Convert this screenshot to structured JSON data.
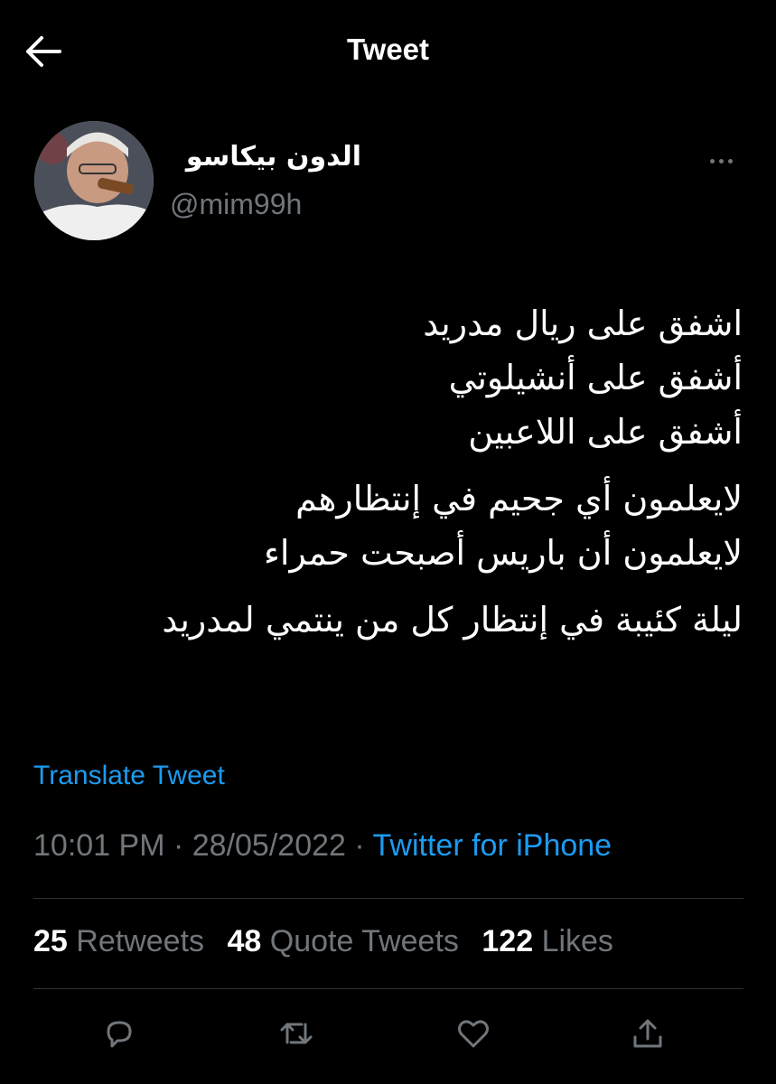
{
  "header": {
    "title": "Tweet"
  },
  "author": {
    "display_name": "الدون بيكاسو",
    "handle": "@mim99h"
  },
  "tweet": {
    "paragraphs": [
      [
        "اشفق على ريال مدريد",
        "أشفق على أنشيلوتي",
        "أشفق على اللاعبين"
      ],
      [
        "لايعلمون أي جحيم في إنتظارهم",
        "لايعلمون أن باريس أصبحت حمراء"
      ],
      [
        "ليلة كئيبة في إنتظار كل من ينتمي لمدريد"
      ]
    ],
    "translate_label": "Translate Tweet"
  },
  "meta": {
    "time": "10:01 PM",
    "sep": " · ",
    "date": "28/05/2022",
    "source": "Twitter for iPhone"
  },
  "stats": {
    "retweets": {
      "count": "25",
      "label": "Retweets"
    },
    "quotes": {
      "count": "48",
      "label": "Quote Tweets"
    },
    "likes": {
      "count": "122",
      "label": "Likes"
    }
  },
  "icons": {
    "back": "arrow-left-icon",
    "more": "more-dots-icon",
    "reply": "reply-icon",
    "retweet": "retweet-icon",
    "like": "heart-icon",
    "share": "share-icon"
  },
  "colors": {
    "background": "#000000",
    "link": "#1d9bf0",
    "muted": "#71767b",
    "divider": "#2f3336"
  }
}
